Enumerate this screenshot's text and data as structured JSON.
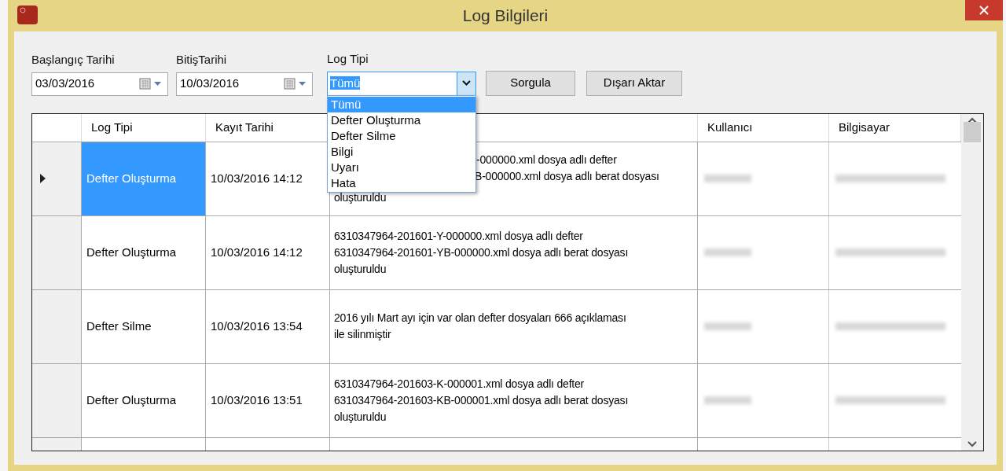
{
  "window": {
    "title": "Log Bilgileri"
  },
  "filters": {
    "start_date": {
      "label": "Başlangıç Tarihi",
      "value": "03/03/2016"
    },
    "end_date": {
      "label": "BitişTarihi",
      "value": "10/03/2016"
    },
    "log_type": {
      "label": "Log Tipi",
      "value": "Tümü",
      "expanded": true,
      "options": [
        {
          "label": "Tümü",
          "selected": true
        },
        {
          "label": "Defter Oluşturma",
          "selected": false
        },
        {
          "label": "Defter Silme",
          "selected": false
        },
        {
          "label": "Bilgi",
          "selected": false
        },
        {
          "label": "Uyarı",
          "selected": false
        },
        {
          "label": "Hata",
          "selected": false
        }
      ]
    }
  },
  "buttons": [
    "Sorgula",
    "Dışarı Aktar"
  ],
  "table": {
    "columns": [
      "Log Tipi",
      "Kayıt Tarihi",
      "Kullanıcı",
      "Bilgisayar"
    ],
    "rows": [
      {
        "selected": true,
        "log_type": "Defter Oluşturma",
        "date": "10/03/2016 14:12",
        "description": [
          "-000000.xml dosya adlı defter",
          "B-000000.xml dosya adlı berat dosyası",
          "oluşturuldu"
        ]
      },
      {
        "selected": false,
        "log_type": "Defter Oluşturma",
        "date": "10/03/2016 14:12",
        "description": [
          "6310347964-201601-Y-000000.xml dosya adlı defter",
          "6310347964-201601-YB-000000.xml dosya adlı berat dosyası",
          "oluşturuldu"
        ]
      },
      {
        "selected": false,
        "log_type": "Defter Silme",
        "date": "10/03/2016 13:54",
        "description": [
          "2016 yılı Mart ayı için var olan defter dosyaları 666 açıklaması",
          "ile silinmiştir"
        ]
      },
      {
        "selected": false,
        "log_type": "Defter Oluşturma",
        "date": "10/03/2016 13:51",
        "description": [
          "6310347964-201603-K-000001.xml dosya adlı defter",
          "6310347964-201603-KB-000001.xml dosya adlı berat dosyası",
          "oluşturuldu"
        ]
      }
    ]
  }
}
